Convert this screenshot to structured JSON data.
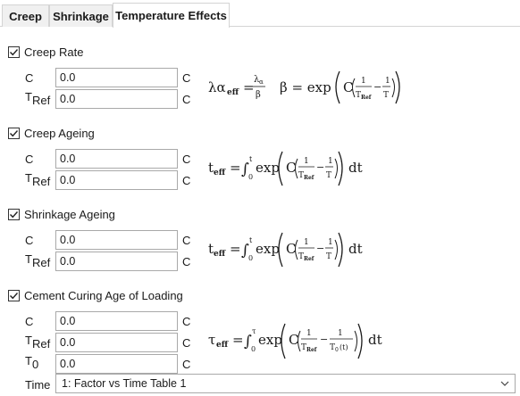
{
  "tabs": [
    {
      "label": "Creep"
    },
    {
      "label": "Shrinkage"
    },
    {
      "label": "Temperature Effects"
    }
  ],
  "sections": {
    "creep_rate": {
      "label": "Creep Rate",
      "checked": true,
      "c_label": "C",
      "c_value": "0.0",
      "c_unit": "C",
      "tref_label": "T",
      "tref_sub": "Ref",
      "tref_value": "0.0",
      "tref_unit": "C"
    },
    "creep_ageing": {
      "label": "Creep Ageing",
      "checked": true,
      "c_label": "C",
      "c_value": "0.0",
      "c_unit": "C",
      "tref_label": "T",
      "tref_sub": "Ref",
      "tref_value": "0.0",
      "tref_unit": "C"
    },
    "shrinkage_ageing": {
      "label": "Shrinkage Ageing",
      "checked": true,
      "c_label": "C",
      "c_value": "0.0",
      "c_unit": "C",
      "tref_label": "T",
      "tref_sub": "Ref",
      "tref_value": "0.0",
      "tref_unit": "C"
    },
    "cement_curing": {
      "label": "Cement Curing Age of Loading",
      "checked": true,
      "c_label": "C",
      "c_value": "0.0",
      "c_unit": "C",
      "tref_label": "T",
      "tref_sub": "Ref",
      "tref_value": "0.0",
      "tref_unit": "C",
      "t0_label": "T",
      "t0_sub": "0",
      "t0_value": "0.0",
      "t0_unit": "C"
    }
  },
  "time": {
    "label": "Time",
    "selected": "1: Factor vs Time Table 1"
  },
  "icons": {
    "checkbox": "checkmark-icon",
    "dropdown": "chevron-down-icon"
  }
}
